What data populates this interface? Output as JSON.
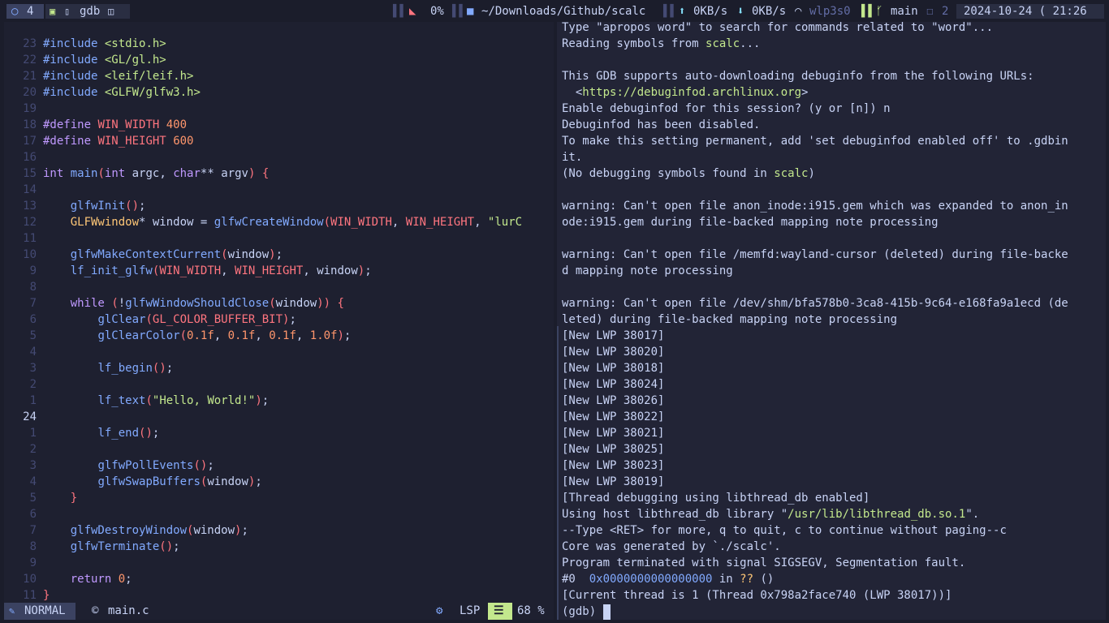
{
  "topbar": {
    "workspace": "4",
    "app": "gdb",
    "mute_percent": "0%",
    "path": "~/Downloads/Github/scalc",
    "net_up": "0KB/s",
    "net_down": "0KB/s",
    "iface": "wlp3s0",
    "branch": "main",
    "branch_count": "2",
    "datetime": "2024-10-24 ( 21:26"
  },
  "editor": {
    "lines": [
      {
        "num": "23",
        "code": "#include <stdio.h>"
      },
      {
        "num": "22",
        "code": "#include <GL/gl.h>"
      },
      {
        "num": "21",
        "code": "#include <leif/leif.h>"
      },
      {
        "num": "20",
        "code": "#include <GLFW/glfw3.h>"
      },
      {
        "num": "19",
        "code": ""
      },
      {
        "num": "18",
        "code": "#define WIN_WIDTH 400"
      },
      {
        "num": "17",
        "code": "#define WIN_HEIGHT 600"
      },
      {
        "num": "16",
        "code": ""
      },
      {
        "num": "15",
        "code": "int main(int argc, char** argv) {"
      },
      {
        "num": "14",
        "code": ""
      },
      {
        "num": "13",
        "code": "    glfwInit();"
      },
      {
        "num": "12",
        "code": "    GLFWwindow* window = glfwCreateWindow(WIN_WIDTH, WIN_HEIGHT, \"lurC"
      },
      {
        "num": "11",
        "code": ""
      },
      {
        "num": "10",
        "code": "    glfwMakeContextCurrent(window);"
      },
      {
        "num": "9",
        "code": "    lf_init_glfw(WIN_WIDTH, WIN_HEIGHT, window);"
      },
      {
        "num": "8",
        "code": ""
      },
      {
        "num": "7",
        "code": "    while (!glfwWindowShouldClose(window)) {"
      },
      {
        "num": "6",
        "code": "        glClear(GL_COLOR_BUFFER_BIT);"
      },
      {
        "num": "5",
        "code": "        glClearColor(0.1f, 0.1f, 0.1f, 1.0f);"
      },
      {
        "num": "4",
        "code": ""
      },
      {
        "num": "3",
        "code": "        lf_begin();"
      },
      {
        "num": "2",
        "code": ""
      },
      {
        "num": "1",
        "code": "        lf_text(\"Hello, World!\");"
      },
      {
        "num": "24",
        "code": ""
      },
      {
        "num": "1",
        "code": "        lf_end();"
      },
      {
        "num": "2",
        "code": ""
      },
      {
        "num": "3",
        "code": "        glfwPollEvents();"
      },
      {
        "num": "4",
        "code": "        glfwSwapBuffers(window);"
      },
      {
        "num": "5",
        "code": "    }"
      },
      {
        "num": "6",
        "code": ""
      },
      {
        "num": "7",
        "code": "    glfwDestroyWindow(window);"
      },
      {
        "num": "8",
        "code": "    glfwTerminate();"
      },
      {
        "num": "9",
        "code": ""
      },
      {
        "num": "10",
        "code": "    return 0;"
      },
      {
        "num": "11",
        "code": "}"
      }
    ],
    "current_line_index": 23
  },
  "statusline": {
    "mode": "NORMAL",
    "file": "main.c",
    "lsp": "LSP",
    "percent": "68 %"
  },
  "gdb": {
    "lines": [
      "Type \"apropos word\" to search for commands related to \"word\"...",
      "Reading symbols from scalc...",
      "",
      "This GDB supports auto-downloading debuginfo from the following URLs:",
      "  <https://debuginfod.archlinux.org>",
      "Enable debuginfod for this session? (y or [n]) n",
      "Debuginfod has been disabled.",
      "To make this setting permanent, add 'set debuginfod enabled off' to .gdbin",
      "it.",
      "(No debugging symbols found in scalc)",
      "",
      "warning: Can't open file anon_inode:i915.gem which was expanded to anon_in",
      "ode:i915.gem during file-backed mapping note processing",
      "",
      "warning: Can't open file /memfd:wayland-cursor (deleted) during file-backe",
      "d mapping note processing",
      "",
      "warning: Can't open file /dev/shm/bfa578b0-3ca8-415b-9c64-e168fa9a1ecd (de",
      "leted) during file-backed mapping note processing",
      "[New LWP 38017]",
      "[New LWP 38020]",
      "[New LWP 38018]",
      "[New LWP 38024]",
      "[New LWP 38026]",
      "[New LWP 38022]",
      "[New LWP 38021]",
      "[New LWP 38025]",
      "[New LWP 38023]",
      "[New LWP 38019]",
      "[Thread debugging using libthread_db enabled]",
      "Using host libthread_db library \"/usr/lib/libthread_db.so.1\".",
      "--Type <RET> for more, q to quit, c to continue without paging--c",
      "Core was generated by `./scalc'.",
      "Program terminated with signal SIGSEGV, Segmentation fault.",
      "#0  0x0000000000000000 in ?? ()",
      "[Current thread is 1 (Thread 0x798a2face740 (LWP 38017))]",
      "(gdb) "
    ]
  },
  "colors": {
    "accent": "#82aaff",
    "green": "#c3e88d",
    "orange": "#ff966c",
    "purple": "#c099ff",
    "red": "#ff757f",
    "yellow": "#ffc777"
  }
}
